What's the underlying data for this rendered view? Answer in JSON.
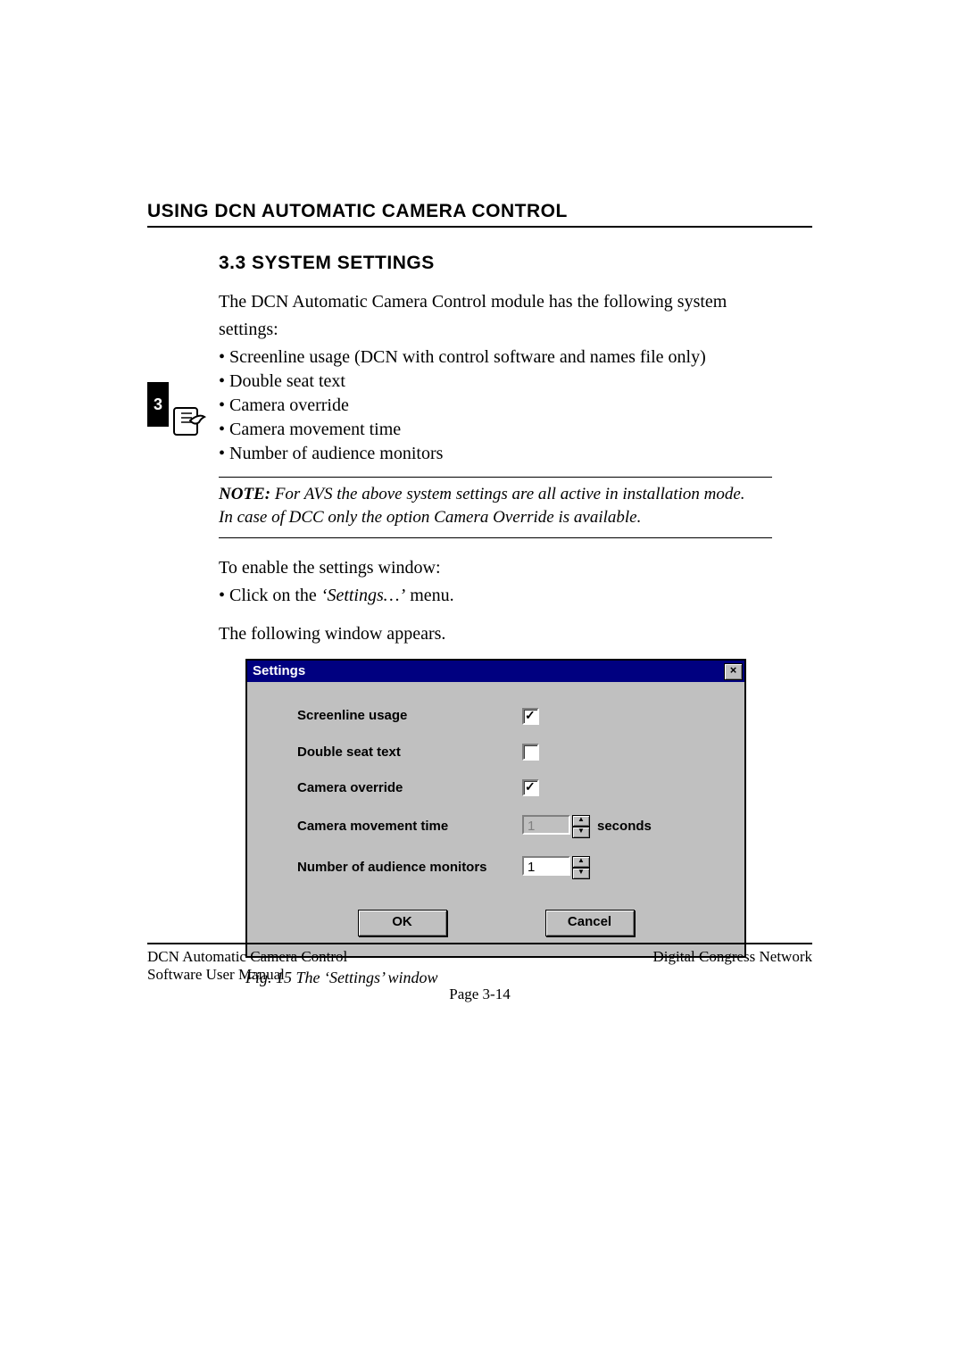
{
  "header": {
    "running_head": "USING DCN AUTOMATIC CAMERA CONTROL"
  },
  "chapter_tab": "3",
  "section": {
    "number_title": "3.3 SYSTEM SETTINGS",
    "intro_line1": "The DCN Automatic Camera Control module has the following system",
    "intro_line2": "settings:",
    "bullets": [
      "Screenline usage (DCN with control software and names file only)",
      "Double seat text",
      "Camera override",
      "Camera movement time",
      "Number of audience monitors"
    ],
    "note_label": "NOTE:",
    "note_line1": " For AVS the above system settings are all active in installation mode.",
    "note_line2": "In case of DCC only the option Camera Override is available.",
    "enable_line": "To enable the settings window:",
    "enable_bullet_pre": "Click on the ",
    "enable_bullet_em": "‘Settings…’",
    "enable_bullet_post": " menu.",
    "appears_line": "The following window appears."
  },
  "dialog": {
    "title": "Settings",
    "close_glyph": "×",
    "rows": {
      "screenline": {
        "label": "Screenline usage",
        "checked": true
      },
      "doubleseat": {
        "label": "Double seat text",
        "checked": false
      },
      "override": {
        "label": "Camera override",
        "checked": true
      },
      "movetime": {
        "label": "Camera movement time",
        "value": "1",
        "unit": "seconds"
      },
      "monitors": {
        "label": "Number of audience monitors",
        "value": "1"
      }
    },
    "ok": "OK",
    "cancel": "Cancel"
  },
  "figure_caption": "Fig. 15 The ‘Settings’ window",
  "footer": {
    "left1": "DCN Automatic Camera Control",
    "left2": "Software User Manual",
    "right": "Digital Congress Network",
    "page": "Page 3-14"
  }
}
